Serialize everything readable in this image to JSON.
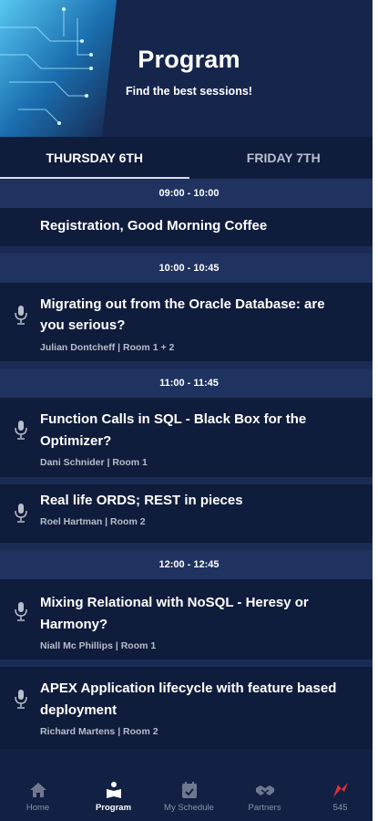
{
  "header": {
    "title": "Program",
    "subtitle": "Find the best sessions!"
  },
  "tabs": [
    {
      "label": "THURSDAY 6TH",
      "active": true
    },
    {
      "label": "FRIDAY 7TH",
      "active": false
    }
  ],
  "schedule": [
    {
      "time": "09:00 - 10:00",
      "sessions": [
        {
          "title": "Registration, Good Morning Coffee",
          "meta": "",
          "icon": ""
        }
      ]
    },
    {
      "time": "10:00 - 10:45",
      "sessions": [
        {
          "title_lines": [
            "Migrating out from the Oracle Database: are",
            "you serious?"
          ],
          "meta": "Julian Dontcheff | Room 1 + 2",
          "icon": "microphone-icon"
        }
      ]
    },
    {
      "time": "11:00 - 11:45",
      "sessions": [
        {
          "title_lines": [
            "Function Calls in SQL - Black Box for the",
            "Optimizer?"
          ],
          "meta": "Dani Schnider | Room 1",
          "icon": "microphone-icon"
        },
        {
          "title_lines": [
            "Real life ORDS; REST in pieces"
          ],
          "meta": "Roel Hartman | Room 2",
          "icon": "microphone-icon"
        }
      ]
    },
    {
      "time": "12:00 - 12:45",
      "sessions": [
        {
          "title_lines": [
            "Mixing Relational with NoSQL - Heresy or",
            "Harmony?"
          ],
          "meta": "Niall Mc Phillips | Room 1",
          "icon": "microphone-icon"
        },
        {
          "title_lines": [
            "APEX Application lifecycle with feature based",
            "deployment"
          ],
          "meta": "Richard Martens | Room 2",
          "icon": "microphone-icon"
        }
      ]
    }
  ],
  "nav": [
    {
      "label": "Home",
      "icon": "home-icon",
      "active": false
    },
    {
      "label": "Program",
      "icon": "program-icon",
      "active": true
    },
    {
      "label": "My Schedule",
      "icon": "calendar-icon",
      "active": false
    },
    {
      "label": "Partners",
      "icon": "handshake-icon",
      "active": false
    },
    {
      "label": "545",
      "icon": "brand-logo-icon",
      "active": false
    }
  ],
  "colors": {
    "background": "#122043",
    "session_bg": "#101c3b",
    "time_header_bg": "#1f3260",
    "brand_red": "#d9303c"
  }
}
